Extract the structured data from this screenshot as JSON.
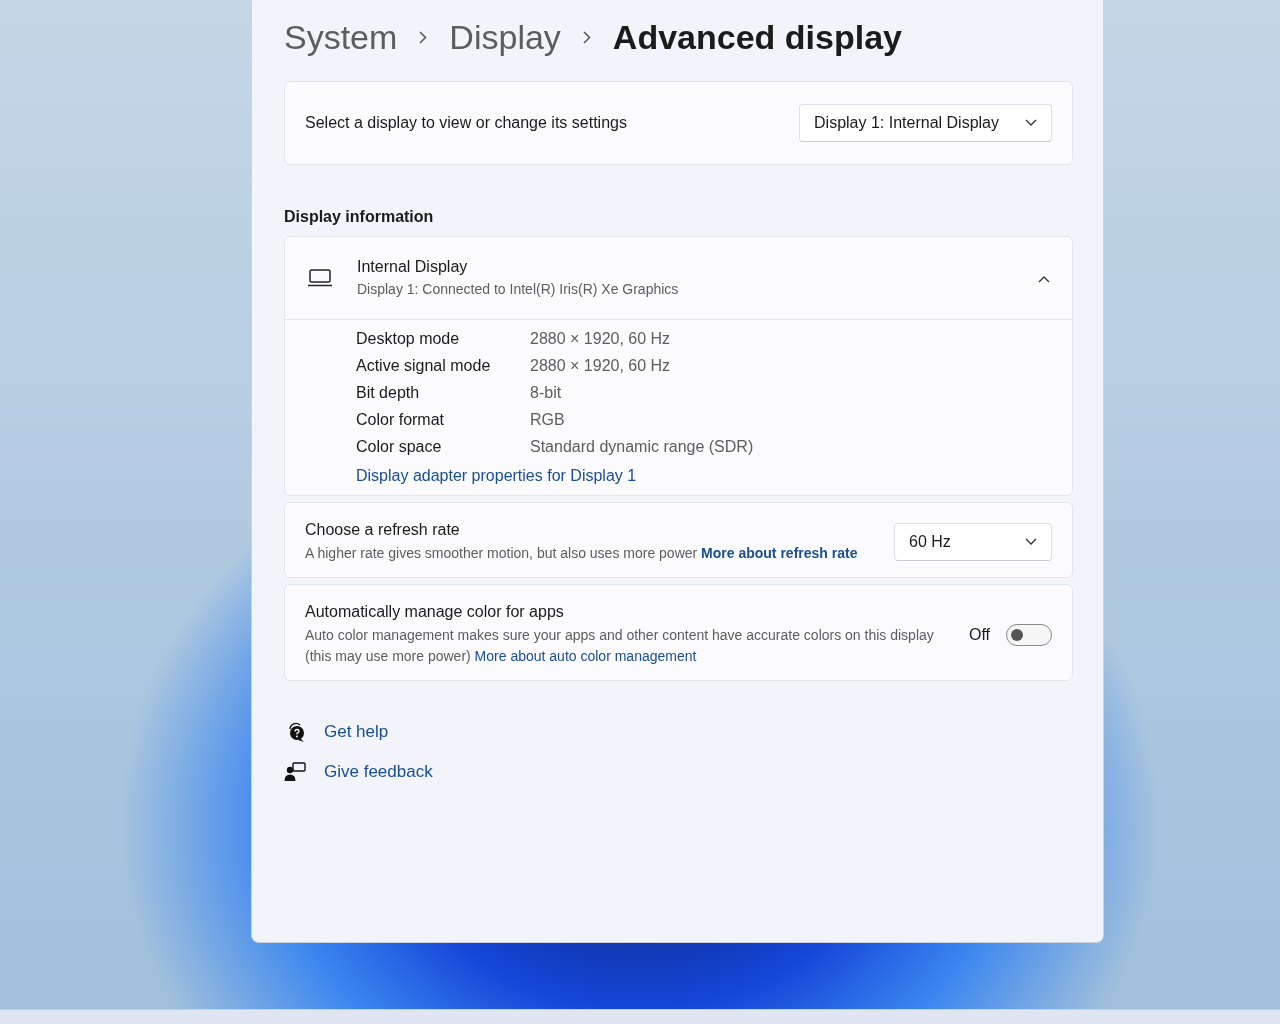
{
  "breadcrumb": [
    {
      "label": "System",
      "current": false
    },
    {
      "label": "Display",
      "current": false
    },
    {
      "label": "Advanced display",
      "current": true
    }
  ],
  "display_selector": {
    "label": "Select a display to view or change its settings",
    "value": "Display 1: Internal Display"
  },
  "section_heading": "Display information",
  "display_info": {
    "title": "Internal Display",
    "subtitle": "Display 1: Connected to Intel(R) Iris(R) Xe Graphics",
    "expanded": true,
    "details": [
      {
        "label": "Desktop mode",
        "value": "2880 × 1920, 60 Hz"
      },
      {
        "label": "Active signal mode",
        "value": "2880 × 1920, 60 Hz"
      },
      {
        "label": "Bit depth",
        "value": "8-bit"
      },
      {
        "label": "Color format",
        "value": "RGB"
      },
      {
        "label": "Color space",
        "value": "Standard dynamic range (SDR)"
      }
    ],
    "link": "Display adapter properties for Display 1"
  },
  "refresh_rate": {
    "title": "Choose a refresh rate",
    "description": "A higher rate gives smoother motion, but also uses more power",
    "link": "More about refresh rate",
    "value": "60 Hz"
  },
  "auto_color": {
    "title": "Automatically manage color for apps",
    "description": "Auto color management makes sure your apps and other content have accurate colors on this display (this may use more power)",
    "link": "More about auto color management",
    "state_label": "Off",
    "on": false
  },
  "help_links": [
    {
      "kind": "help",
      "label": "Get help"
    },
    {
      "kind": "feedback",
      "label": "Give feedback"
    }
  ]
}
